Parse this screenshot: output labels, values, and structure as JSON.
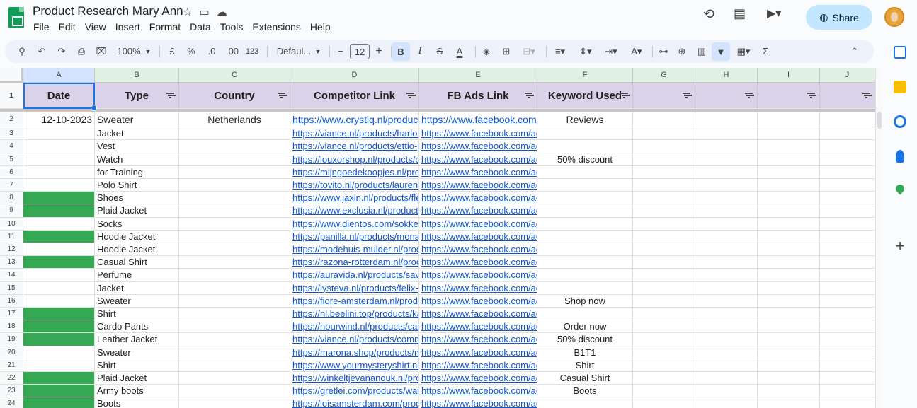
{
  "app": {
    "title": "Product Research Mary Ann",
    "menus": [
      "File",
      "Edit",
      "View",
      "Insert",
      "Format",
      "Data",
      "Tools",
      "Extensions",
      "Help"
    ],
    "share_label": "Share"
  },
  "toolbar": {
    "zoom": "100%",
    "currency": "£",
    "percent": "%",
    "dec_less": ".0",
    "dec_more": ".00",
    "number_format": "123",
    "font": "Defaul...",
    "font_size": "12",
    "bold": "B",
    "italic": "I",
    "strike": "S",
    "text_color": "A",
    "sigma": "Σ"
  },
  "columns": [
    "A",
    "B",
    "C",
    "D",
    "E",
    "F",
    "G",
    "H",
    "I",
    "J"
  ],
  "headers": [
    "Date",
    "Type",
    "Country",
    "Competitor Link",
    "FB Ads Link",
    "Keyword Used"
  ],
  "rows": [
    {
      "n": "2",
      "date": "12-10-2023",
      "type": "Sweater",
      "country": "Netherlands",
      "comp": "https://www.crystiq.nl/products/l",
      "fb": "https://www.facebook.com/ac",
      "kw": "Reviews",
      "green": false
    },
    {
      "n": "3",
      "date": "",
      "type": "Jacket",
      "country": "",
      "comp": "https://viance.nl/products/harlo-win",
      "fb": "https://www.facebook.com/ads/l",
      "kw": "",
      "green": false
    },
    {
      "n": "4",
      "date": "",
      "type": "Vest",
      "country": "",
      "comp": "https://viance.nl/products/ettio-prer",
      "fb": "https://www.facebook.com/ads/l",
      "kw": "",
      "green": false
    },
    {
      "n": "5",
      "date": "",
      "type": "Watch",
      "country": "",
      "comp": "https://louxorshop.nl/products/omn",
      "fb": "https://www.facebook.com/ads/l",
      "kw": "50% discount",
      "green": false
    },
    {
      "n": "6",
      "date": "",
      "type": "for Training",
      "country": "",
      "comp": "https://mijngoedekoopjes.nl/produc",
      "fb": "https://www.facebook.com/ads/l",
      "kw": "",
      "green": false
    },
    {
      "n": "7",
      "date": "",
      "type": "Polo Shirt",
      "country": "",
      "comp": "https://tovito.nl/products/laurens",
      "fb": "https://www.facebook.com/ads/l",
      "kw": "",
      "green": false
    },
    {
      "n": "8",
      "date": "",
      "type": "Shoes",
      "country": "",
      "comp": "https://www.jaxin.nl/products/flexis",
      "fb": "https://www.facebook.com/ads/l",
      "kw": "",
      "green": true
    },
    {
      "n": "9",
      "date": "",
      "type": "Plaid Jacket",
      "country": "",
      "comp": "https://www.exclusia.nl/products/pl",
      "fb": "https://www.facebook.com/ads/l",
      "kw": "",
      "green": true
    },
    {
      "n": "10",
      "date": "",
      "type": "Socks",
      "country": "",
      "comp": "https://www.dientos.com/sokken",
      "fb": "https://www.facebook.com/ads/l",
      "kw": "",
      "green": false
    },
    {
      "n": "11",
      "date": "",
      "type": "Hoodie Jacket",
      "country": "",
      "comp": "https://panilla.nl/products/monaco-",
      "fb": "https://www.facebook.com/ads/l",
      "kw": "",
      "green": true
    },
    {
      "n": "12",
      "date": "",
      "type": "Hoodie Jacket",
      "country": "",
      "comp": "https://modehuis-mulder.nl/product",
      "fb": "https://www.facebook.com/ads/l",
      "kw": "",
      "green": false
    },
    {
      "n": "13",
      "date": "",
      "type": "Casual Shirt",
      "country": "",
      "comp": "https://razona-rotterdam.nl/product",
      "fb": "https://www.facebook.com/ads/l",
      "kw": "",
      "green": true
    },
    {
      "n": "14",
      "date": "",
      "type": "Perfume",
      "country": "",
      "comp": "https://auravida.nl/products/savage",
      "fb": "https://www.facebook.com/ads/l",
      "kw": "",
      "green": false
    },
    {
      "n": "15",
      "date": "",
      "type": "Jacket",
      "country": "",
      "comp": "https://lysteva.nl/products/felix-all-s",
      "fb": "https://www.facebook.com/ads/l",
      "kw": "",
      "green": false
    },
    {
      "n": "16",
      "date": "",
      "type": "Sweater",
      "country": "",
      "comp": "https://fiore-amsterdam.nl/products",
      "fb": "https://www.facebook.com/ads/l",
      "kw": "Shop now",
      "green": false
    },
    {
      "n": "17",
      "date": "",
      "type": "Shirt",
      "country": "",
      "comp": "https://nl.beelini.top/products/katar",
      "fb": "https://www.facebook.com/ads/l",
      "kw": "",
      "green": true
    },
    {
      "n": "18",
      "date": "",
      "type": "Cardo Pants",
      "country": "",
      "comp": "https://nourwind.nl/products/cargo",
      "fb": "https://www.facebook.com/ads/l",
      "kw": "Order now",
      "green": true
    },
    {
      "n": "19",
      "date": "",
      "type": "Leather Jacket",
      "country": "",
      "comp": "https://viance.nl/products/comman",
      "fb": "https://www.facebook.com/ads/l",
      "kw": "50% discount",
      "green": true
    },
    {
      "n": "20",
      "date": "",
      "type": "Sweater",
      "country": "",
      "comp": "https://marona.shop/products/mec",
      "fb": "https://www.facebook.com/ads/l",
      "kw": "B1T1",
      "green": false
    },
    {
      "n": "21",
      "date": "",
      "type": "Shirt",
      "country": "",
      "comp": "https://www.yourmysteryshirt.nl/prc",
      "fb": "https://www.facebook.com/ads/l",
      "kw": "Shirt",
      "green": false
    },
    {
      "n": "22",
      "date": "",
      "type": "Plaid Jacket",
      "country": "",
      "comp": "https://winkeltjevananouk.nl/produ",
      "fb": "https://www.facebook.com/ads/l",
      "kw": "Casual Shirt",
      "green": true
    },
    {
      "n": "23",
      "date": "",
      "type": "Army boots",
      "country": "",
      "comp": "https://gretlei.com/products/warme",
      "fb": "https://www.facebook.com/ads/l",
      "kw": "Boots",
      "green": true
    },
    {
      "n": "24",
      "date": "",
      "type": "Boots",
      "country": "",
      "comp": "https://loisamsterdam.com/product",
      "fb": "https://www.facebook.com/ads/l",
      "kw": "",
      "green": true
    }
  ],
  "colors": {
    "header_fill": "#d9d2e9",
    "green_fill": "#34a853",
    "link": "#1155cc",
    "accent": "#1a73e8"
  }
}
